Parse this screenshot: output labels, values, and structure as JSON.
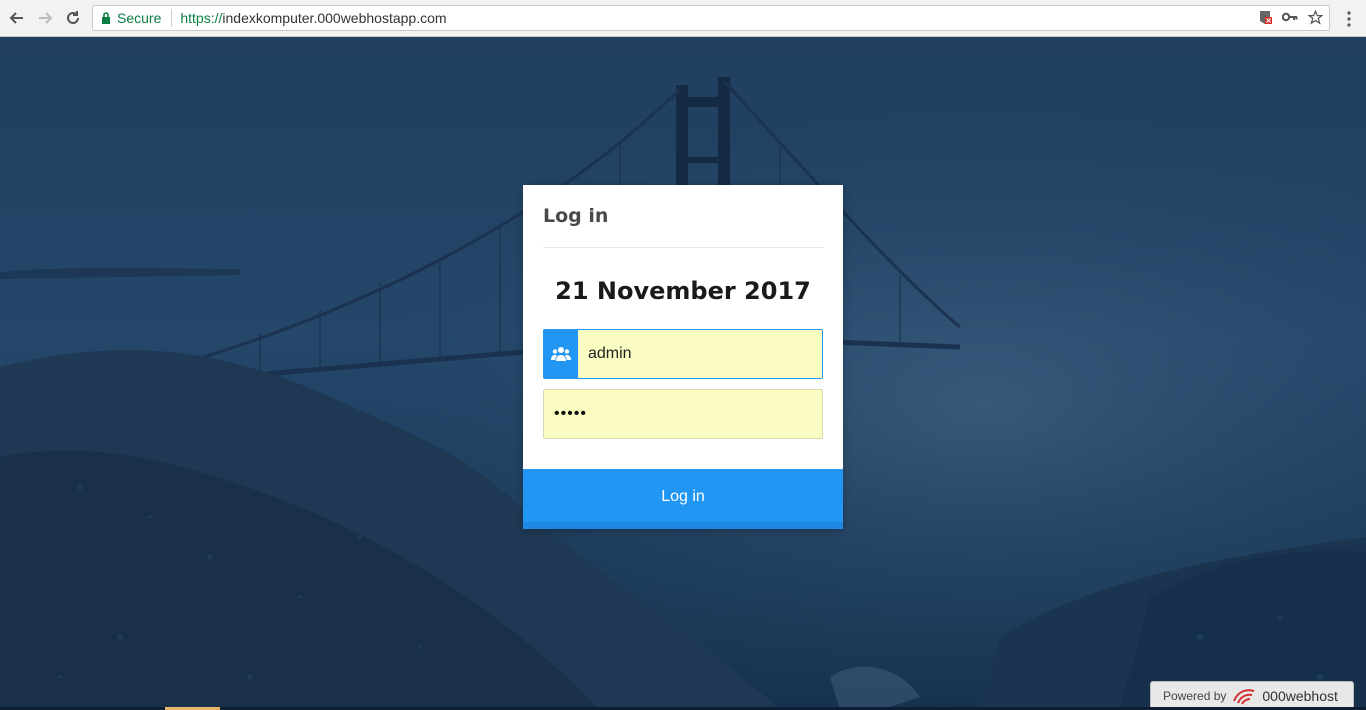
{
  "browser": {
    "secure_label": "Secure",
    "url_scheme": "https://",
    "url_host": "indexkomputer.000webhostapp.com"
  },
  "login": {
    "title": "Log in",
    "date": "21 November 2017",
    "username_value": "admin",
    "password_mask": "•••••",
    "submit_label": "Log in"
  },
  "footer": {
    "powered_by": "Powered by",
    "brand": "000webhost"
  },
  "colors": {
    "accent": "#2196f3",
    "autofill": "#fafcc2",
    "secure_green": "#0b8043"
  }
}
